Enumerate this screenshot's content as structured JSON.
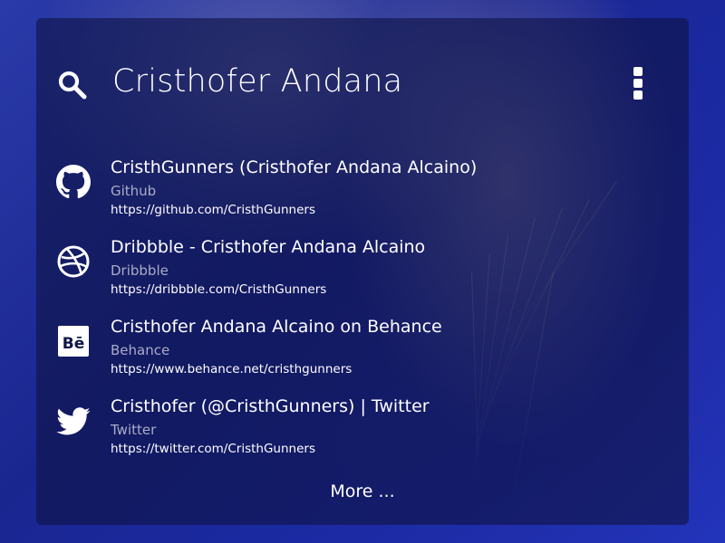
{
  "search": {
    "query": "Cristhofer Andana",
    "icon": "search-icon"
  },
  "menu": {
    "icon": "more-vertical-icon"
  },
  "results": [
    {
      "title": "CristhGunners (Cristhofer Andana Alcaino)",
      "source": "Github",
      "url": "https://github.com/CristhGunners",
      "icon": "github-icon"
    },
    {
      "title": "Dribbble - Cristhofer Andana Alcaino",
      "source": "Dribbble",
      "url": "https://dribbble.com/CristhGunners",
      "icon": "dribbble-icon"
    },
    {
      "title": "Cristhofer Andana Alcaino on Behance",
      "source": "Behance",
      "url": "https://www.behance.net/cristhgunners",
      "icon": "behance-icon"
    },
    {
      "title": "Cristhofer (@CristhGunners) | Twitter",
      "source": "Twitter",
      "url": "https://twitter.com/CristhGunners",
      "icon": "twitter-icon"
    }
  ],
  "more_label": "More ...",
  "colors": {
    "panel_bg": "#0e1446",
    "text_primary": "#ffffff",
    "text_secondary": "#a9adc6",
    "background_blue": "#1b2aa6"
  }
}
